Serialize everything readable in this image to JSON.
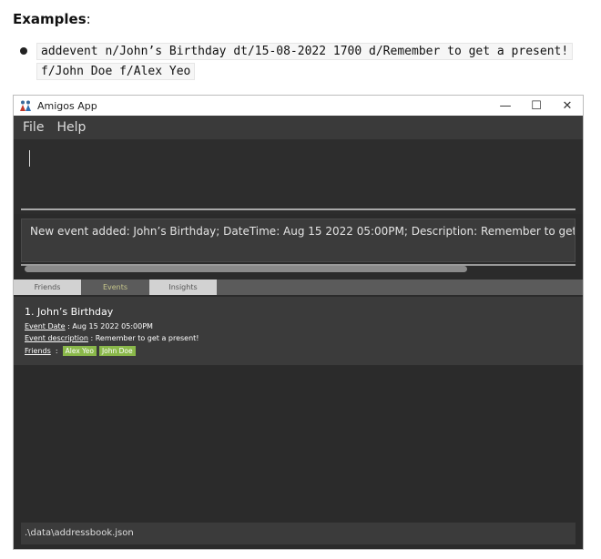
{
  "doc": {
    "heading": "Examples",
    "heading_suffix": ":",
    "code_line1": "addevent n/John’s Birthday dt/15-08-2022 1700 d/Remember to get a present!",
    "code_line2": "f/John Doe f/Alex Yeo"
  },
  "window": {
    "title": "Amigos App",
    "minimize": "—",
    "maximize": "☐",
    "close": "✕"
  },
  "menu": {
    "file": "File",
    "help": "Help"
  },
  "command_input": {
    "value": ""
  },
  "result": {
    "text": "New event added: John’s Birthday; DateTime: Aug 15 2022 05:00PM; Description: Remember to get a present!; Fri"
  },
  "tabs": [
    {
      "label": "Friends"
    },
    {
      "label": "Events"
    },
    {
      "label": "Insights"
    }
  ],
  "event": {
    "title": "1.  John’s Birthday",
    "date_label": "Event Date",
    "date_value": " : Aug 15 2022 05:00PM",
    "desc_label": "Event description",
    "desc_value": " : Remember to get a present!",
    "friends_label": "Friends",
    "friends_sep": "  :  ",
    "friends": [
      "Alex Yeo",
      "John Doe"
    ]
  },
  "status": {
    "path": ".\\data\\addressbook.json"
  },
  "colors": {
    "window_bg": "#2b2b2b",
    "tag_bg": "#8ab84a",
    "active_tab_text": "#c6c68a"
  }
}
